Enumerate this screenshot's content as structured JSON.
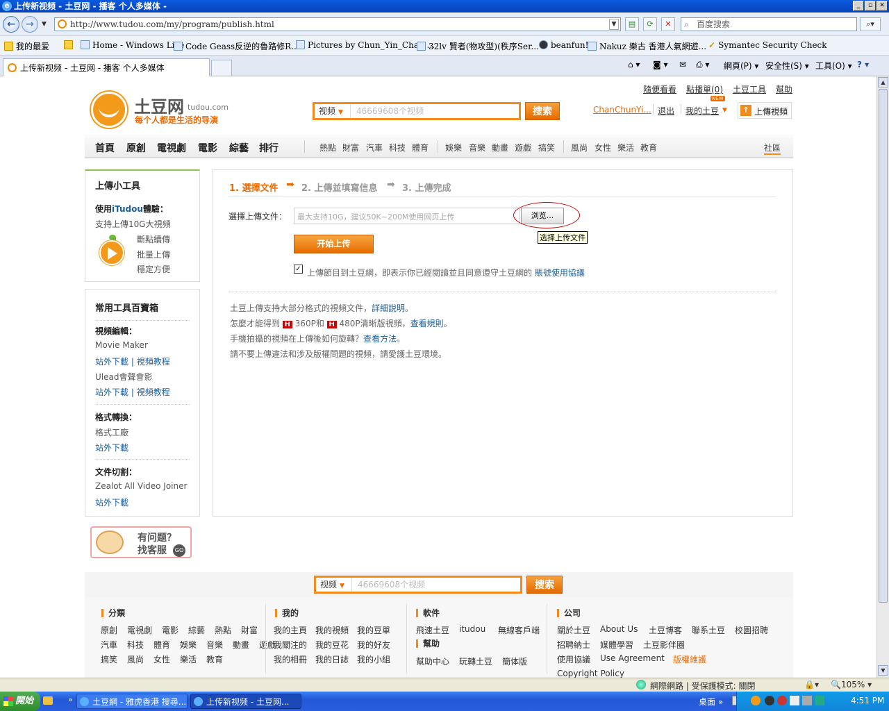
{
  "window": {
    "title": "上传新视频 - 土豆网 - 播客 个人多媒体 -"
  },
  "browser": {
    "address": "http://www.tudou.com/my/program/publish.html",
    "search_placeholder": "百度搜索",
    "favorites": [
      "我的最爱",
      "Home - Windows Live",
      "Code Geass反逆的魯路修R...",
      "Pictures by Chun_Yin_Chan ...",
      "32lv 賢者(物攻型)(秩序Ser...",
      "beanfun!",
      "Nakuz 樂古 香港人氣網遊...",
      "Symantec Security Check"
    ],
    "tab_title": "上传新视频 - 土豆网 - 播客 个人多媒体",
    "commands": {
      "page": "網頁(P)",
      "safety": "安全性(S)",
      "tools": "工具(O)"
    }
  },
  "site": {
    "toplinks": [
      "隨便看看",
      "點播單(0)",
      "土豆工具",
      "幫助"
    ],
    "brand": "土豆网",
    "brand_sub": "tudou.com",
    "slogan": "每个人都是生活的导演",
    "search": {
      "category": "视频",
      "placeholder": "46669608个视频",
      "button": "搜索"
    },
    "user": "ChanChunYi...",
    "logout": "退出",
    "my_tudou": "我的土豆",
    "new_badge": "NEW",
    "upload": "上傳視頻",
    "nav_main": [
      "首頁",
      "原創",
      "電視劇",
      "電影",
      "綜藝",
      "排行"
    ],
    "nav_sub1": [
      "熱點",
      "財富",
      "汽車",
      "科技",
      "體育"
    ],
    "nav_sub2": [
      "娛樂",
      "音樂",
      "動畫",
      "遊戲",
      "搞笑"
    ],
    "nav_sub3": [
      "風尚",
      "女性",
      "樂活",
      "教育"
    ],
    "nav_community": "社區"
  },
  "sidebar": {
    "tools_title": "上傳小工具",
    "itudou_prefix": "使用",
    "itudou_name": "iTudou",
    "itudou_suffix": "體驗：",
    "itudou_desc": "支持上傳10G大視頻",
    "features": [
      "斷點續傳",
      "批量上傳",
      "穩定方便"
    ],
    "box_title": "常用工具百寶箱",
    "sections": [
      {
        "title": "視頻編輯：",
        "items": [
          {
            "name": "Movie Maker",
            "download": "站外下載",
            "tutorial": "視頻教程"
          },
          {
            "name": "Ulead會聲會影",
            "download": "站外下載",
            "tutorial": "視頻教程"
          }
        ]
      },
      {
        "title": "格式轉換：",
        "items": [
          {
            "name": "格式工廠",
            "download": "站外下載"
          }
        ]
      },
      {
        "title": "文件切割：",
        "items": [
          {
            "name": "Zealot All Video Joiner",
            "download": "站外下載"
          }
        ]
      }
    ],
    "help_line1": "有问题？",
    "help_line2": "找客服",
    "help_go": "GO"
  },
  "upload": {
    "steps": [
      "1. 選擇文件",
      "2. 上傳並填寫信息",
      "3. 上傳完成"
    ],
    "file_label": "選擇上傳文件：",
    "file_placeholder": "最大支持10G，建议50K~200M使用网页上传",
    "browse": "浏览...",
    "tooltip": "选择上传文件",
    "start": "开始上传",
    "agree_text": "上傳節目到土豆網，即表示你已經閱讀並且同意遵守土豆網的",
    "agree_link": "賬號使用協議",
    "info1_text": "土豆上傳支持大部分格式的視頻文件，",
    "info1_link": "詳細說明",
    "info1_end": "。",
    "info2_a": "怎麼才能得到",
    "info2_b": "360P和",
    "info2_c": "480P清晰版視頻，",
    "info2_link": "查看規則",
    "info2_end": "。",
    "info3_text": "手機拍攝的視頻在上傳後如何旋轉？",
    "info3_link": "查看方法",
    "info3_end": "。",
    "info4": "請不要上傳違法和涉及版權問題的視頻，請愛護土豆環境。"
  },
  "footer": {
    "cat_title": "分類",
    "cat_rows": [
      [
        "原創",
        "電視劇",
        "電影",
        "綜藝",
        "熱點",
        "財富"
      ],
      [
        "汽車",
        "科技",
        "體育",
        "娛樂",
        "音樂",
        "動畫",
        "遊戲"
      ],
      [
        "搞笑",
        "風尚",
        "女性",
        "樂活",
        "教育"
      ]
    ],
    "my_title": "我的",
    "my_rows": [
      [
        "我的主頁",
        "我的視頻",
        "我的豆單"
      ],
      [
        "我關注的",
        "我的豆花",
        "我的好友"
      ],
      [
        "我的相冊",
        "我的日誌",
        "我的小組"
      ]
    ],
    "soft_title": "軟件",
    "soft_items": [
      "飛速土豆",
      "itudou",
      "無線客戶端"
    ],
    "help_title": "幫助",
    "help_items": [
      "幫助中心",
      "玩轉土豆",
      "簡体版"
    ],
    "co_title": "公司",
    "co_rows": [
      [
        "關於土豆",
        "About Us",
        "土豆博客",
        "聯系土豆",
        "校園招聘"
      ],
      [
        "招聘納士",
        "媒體學習",
        "土豆影伴圈"
      ],
      [
        "使用協議",
        "Use Agreement",
        "版權維護"
      ]
    ],
    "copyright": "Copyright Policy"
  },
  "status": {
    "zone": "網際網路 | 受保護模式: 關閉",
    "zoom": "105%"
  },
  "taskbar": {
    "start": "開始",
    "tasks": [
      "土豆網 - 雅虎香港 搜尋...",
      "上传新视频 - 土豆网..."
    ],
    "desktop": "桌面",
    "time": "4:51 PM"
  },
  "colors": {
    "accent": "#f28b1c",
    "link": "#1a5e9a",
    "title_blue": "#0a5adf"
  }
}
